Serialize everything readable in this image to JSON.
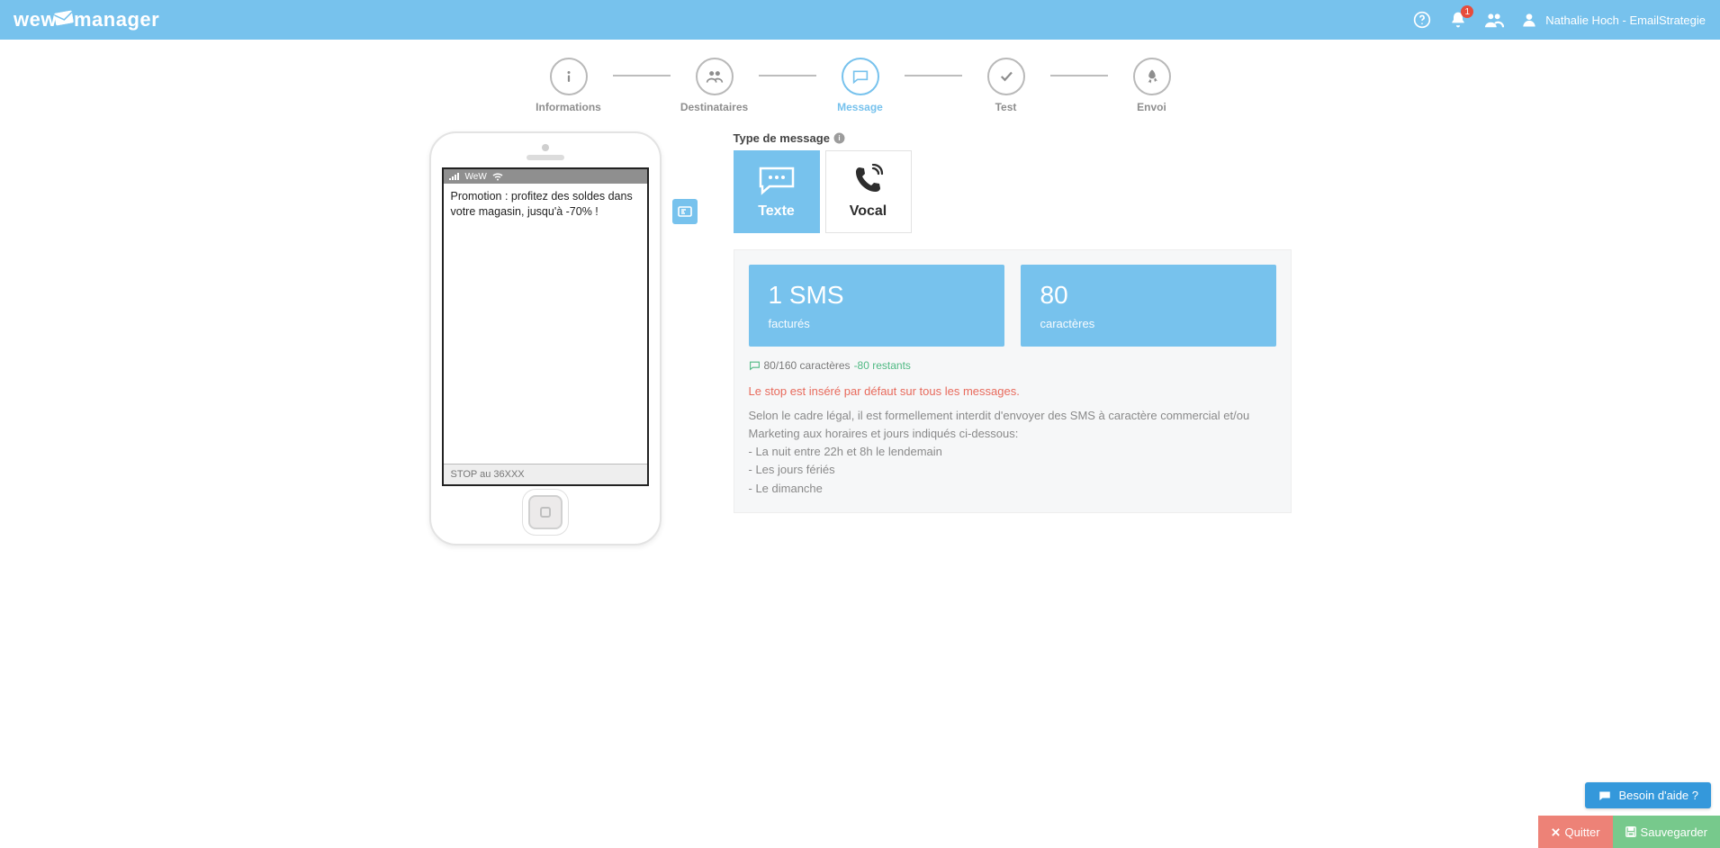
{
  "brand": {
    "name": "wewmanager"
  },
  "header": {
    "notification_count": "1",
    "user_label": "Nathalie Hoch - EmailStrategie"
  },
  "steps": [
    {
      "label": "Informations"
    },
    {
      "label": "Destinataires"
    },
    {
      "label": "Message"
    },
    {
      "label": "Test"
    },
    {
      "label": "Envoi"
    }
  ],
  "phone": {
    "carrier": "WeW",
    "message": "Promotion : profitez des soldes dans votre magasin, jusqu'à -70% !",
    "stop": "STOP au 36XXX"
  },
  "message_type": {
    "title": "Type de message",
    "text_label": "Texte",
    "vocal_label": "Vocal"
  },
  "stats": {
    "sms_count": "1 SMS",
    "sms_sub": "facturés",
    "char_count": "80",
    "char_sub": "caractères",
    "counter_main": "80/160 caractères",
    "counter_rest": "-80 restants"
  },
  "info": {
    "warn": "Le stop est inséré par défaut sur tous les messages.",
    "legal_intro": "Selon le cadre légal, il est formellement interdit d'envoyer des SMS à caractère commercial et/ou Marketing aux horaires et jours indiqués ci-dessous:",
    "legal_1": "- La nuit entre 22h et 8h le lendemain",
    "legal_2": "- Les jours fériés",
    "legal_3": "- Le dimanche"
  },
  "footer": {
    "help": "Besoin d'aide ?",
    "quit": "Quitter",
    "save": "Sauvegarder"
  }
}
